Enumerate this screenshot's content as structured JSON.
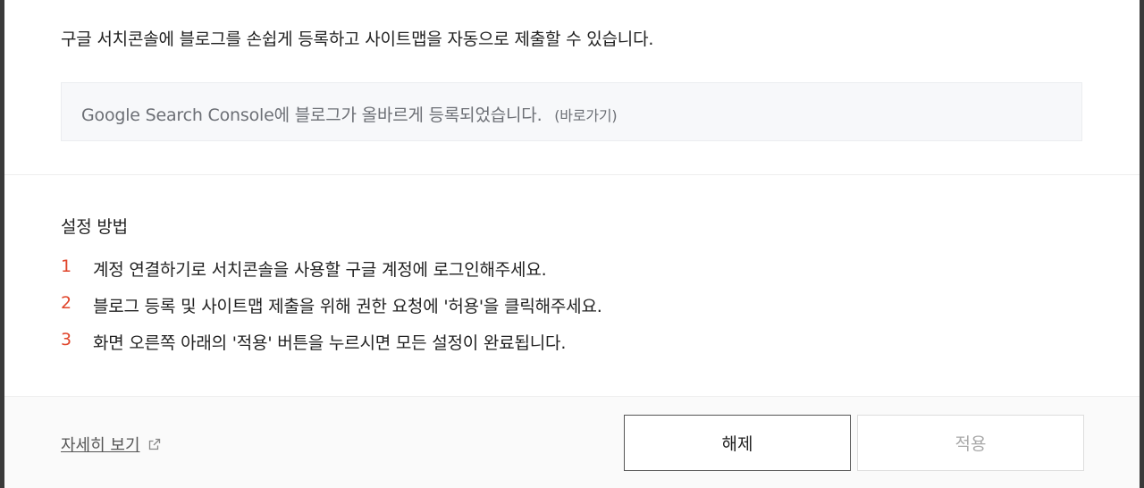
{
  "description": "구글 서치콘솔에 블로그를 손쉽게 등록하고 사이트맵을 자동으로 제출할 수 있습니다.",
  "status": {
    "message": "Google Search Console에 블로그가 올바르게 등록되었습니다.",
    "link_label": "(바로가기)"
  },
  "setup": {
    "title": "설정 방법",
    "steps": [
      {
        "num": "1",
        "text": "계정 연결하기로 서치콘솔을 사용할 구글 계정에 로그인해주세요."
      },
      {
        "num": "2",
        "text": "블로그 등록 및 사이트맵 제출을 위해 권한 요청에 '허용'을 클릭해주세요."
      },
      {
        "num": "3",
        "text": "화면 오른쪽 아래의 '적용' 버튼을 누르시면 모든 설정이 완료됩니다."
      }
    ]
  },
  "footer": {
    "more_link": "자세히 보기",
    "more_link_icon": "external-link-icon",
    "release_button": "해제",
    "apply_button": "적용"
  },
  "colors": {
    "step_number": "#e0452b",
    "disabled_text": "#a9a9a9",
    "status_background": "#f7f8fa"
  }
}
